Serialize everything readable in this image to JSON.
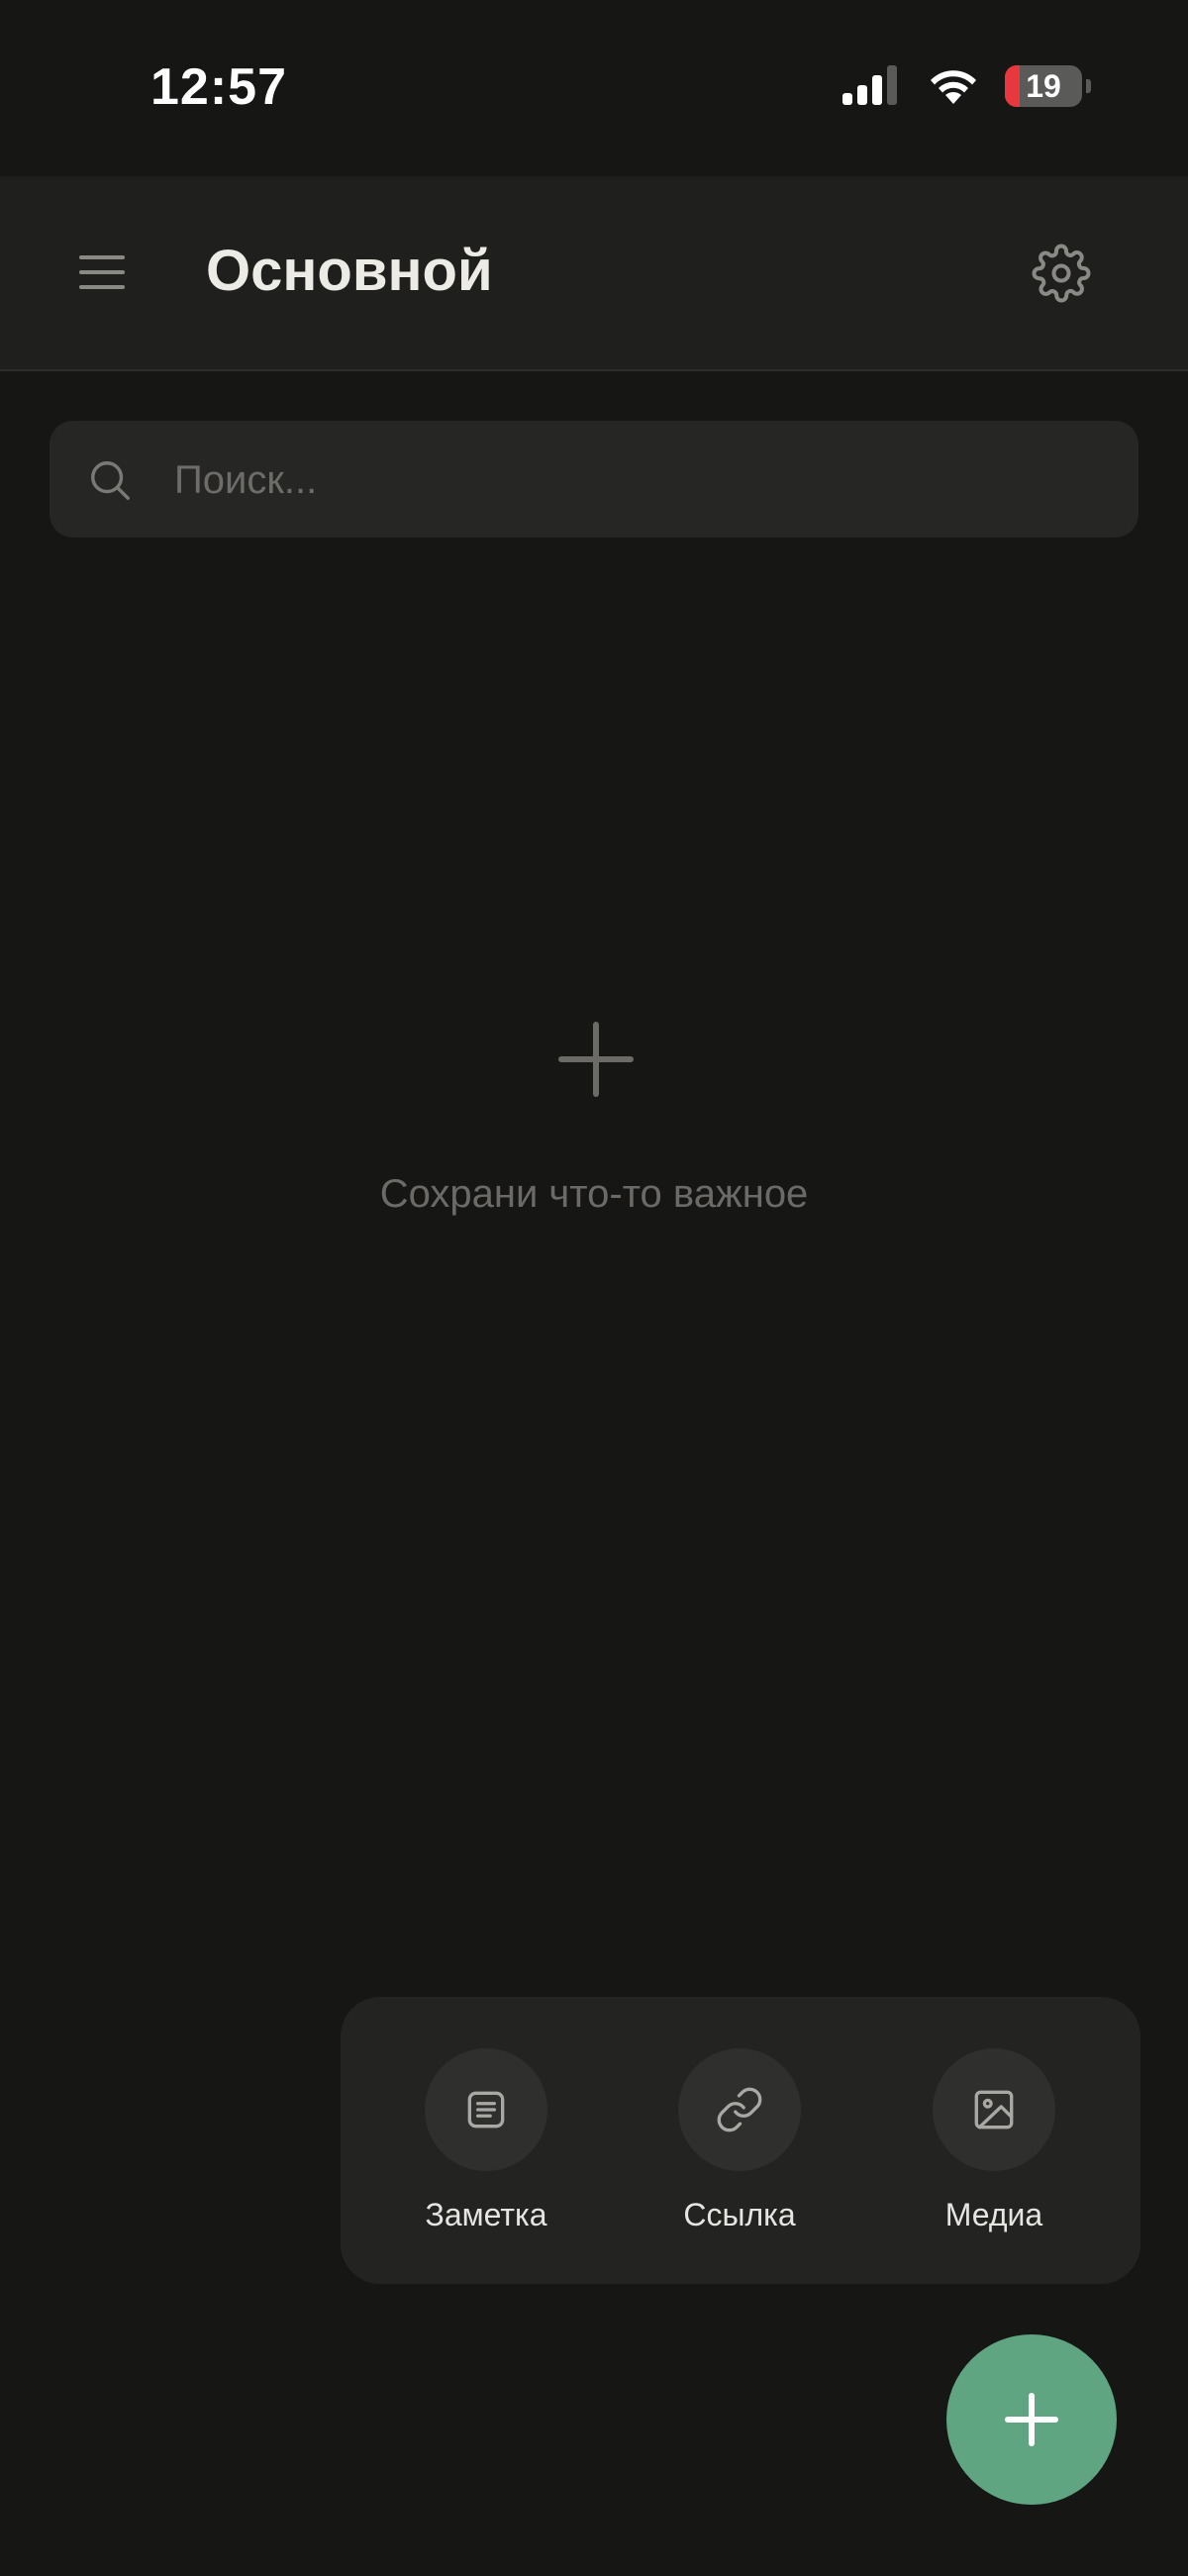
{
  "status_bar": {
    "time": "12:57",
    "battery_level": "19",
    "icons": [
      "signal-icon",
      "wifi-icon",
      "battery-icon"
    ]
  },
  "header": {
    "title": "Основной",
    "icons": [
      "menu-icon",
      "gear-icon"
    ]
  },
  "search": {
    "placeholder": "Поиск...",
    "value": ""
  },
  "empty_state": {
    "text": "Сохрани что-то важное",
    "icon": "plus-icon"
  },
  "quick_menu": {
    "items": [
      {
        "label": "Заметка",
        "icon": "note-icon"
      },
      {
        "label": "Ссылка",
        "icon": "link-icon"
      },
      {
        "label": "Медиа",
        "icon": "image-icon"
      }
    ]
  },
  "fab": {
    "icon": "plus-icon"
  },
  "colors": {
    "background": "#161615",
    "header": "#1f1f1e",
    "accent": "#5fa582",
    "battery_low": "#e8383d"
  }
}
